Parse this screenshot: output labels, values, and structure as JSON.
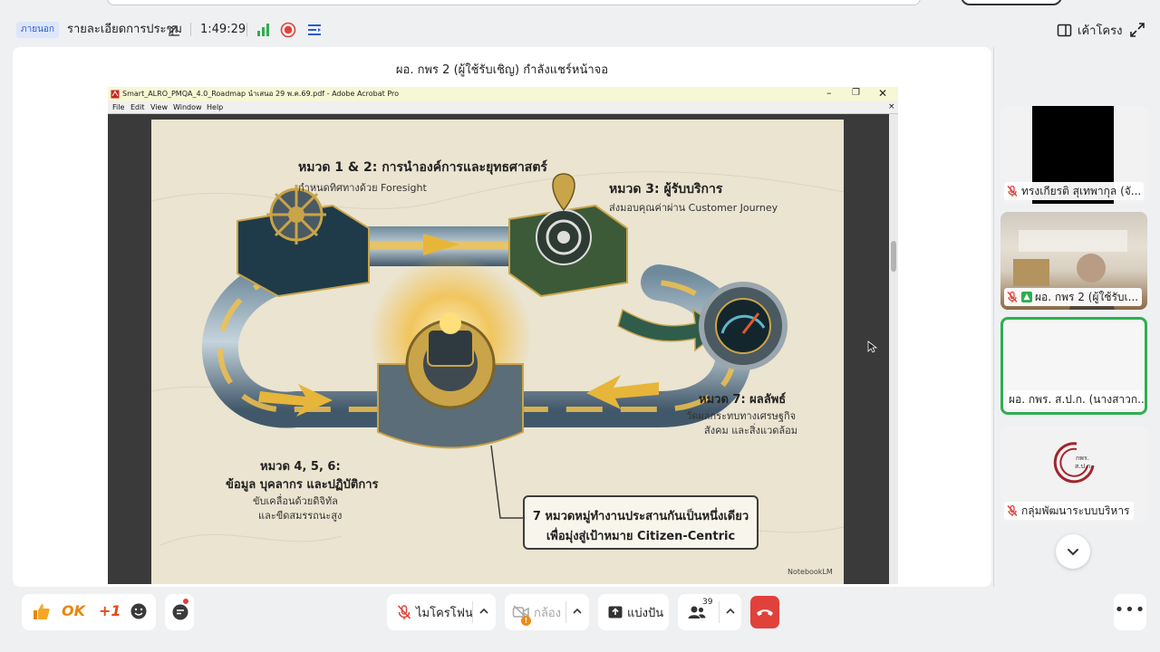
{
  "header": {
    "badge_label": "ภายนอก",
    "meeting_title": "รายละเอียดการประชุม",
    "elapsed_time": "1:49:29",
    "layout_label": "เค้าโครง"
  },
  "stage": {
    "share_caption": "ผอ. กพร 2 (ผู้ใช้รับเชิญ) กำลังแชร์หน้าจอ"
  },
  "acrobat": {
    "window_title": "Smart_ALRO_PMQA_4.0_Roadmap นำเสนอ 29 พ.ค.69.pdf - Adobe Acrobat Pro",
    "menu": [
      "File",
      "Edit",
      "View",
      "Window",
      "Help"
    ],
    "min_glyph": "–",
    "max_glyph": "❐",
    "close_glyph": "✕",
    "doc_close_glyph": "×"
  },
  "slide": {
    "cat12_title": "หมวด 1 & 2: การนำองค์การและยุทธศาสตร์",
    "cat12_sub": "กำหนดทิศทางด้วย Foresight",
    "cat3_title": "หมวด 3: ผู้รับบริการ",
    "cat3_sub": "ส่งมอบคุณค่าผ่าน Customer Journey",
    "cat7_title": "หมวด 7: ผลลัพธ์",
    "cat7_sub1": "วัดผลกระทบทางเศรษฐกิจ",
    "cat7_sub2": "สังคม และสิ่งแวดล้อม",
    "cat456_title1": "หมวด 4, 5, 6:",
    "cat456_title2": "ข้อมูล บุคลากร และปฏิบัติการ",
    "cat456_sub1": "ขับเคลื่อนด้วยดิจิทัล",
    "cat456_sub2": "และขีดสมรรถนะสูง",
    "callout_line1": "7 หมวดหมู่ทำงานประสานกันเป็นหนึ่งเดียว",
    "callout_line2": "เพื่อมุ่งสู่เป้าหมาย Citizen-Centric",
    "watermark": "NotebookLM"
  },
  "participants": [
    {
      "name": "ทรงเกียรติ สุเทพากุล (จั...",
      "muted": true,
      "video": "black"
    },
    {
      "name": "ผอ. กพร 2 (ผู้ใช้รับเ...",
      "muted": true,
      "sharing": true,
      "video": "camera"
    },
    {
      "name": "ผอ. กพร. ส.ป.ก. (นางสาวก...",
      "muted": false,
      "active_speaker": true,
      "video": "off"
    },
    {
      "name": "กลุ่มพัฒนาระบบบริหาร",
      "muted": true,
      "video": "logo",
      "logo_text": "กพร. ส.ป.ก."
    }
  ],
  "controls": {
    "reaction_ok": "OK",
    "reaction_plus": "+1",
    "mic_label": "ไมโครโฟน",
    "camera_label": "กล้อง",
    "share_label": "แบ่งปัน",
    "people_count": "39",
    "camera_warning": "!"
  },
  "colors": {
    "active_border": "#2fae4f",
    "end_call": "#e0413a",
    "mic_off": "#e0413a",
    "record": "#e0413a",
    "signal": "#2fae4f"
  }
}
